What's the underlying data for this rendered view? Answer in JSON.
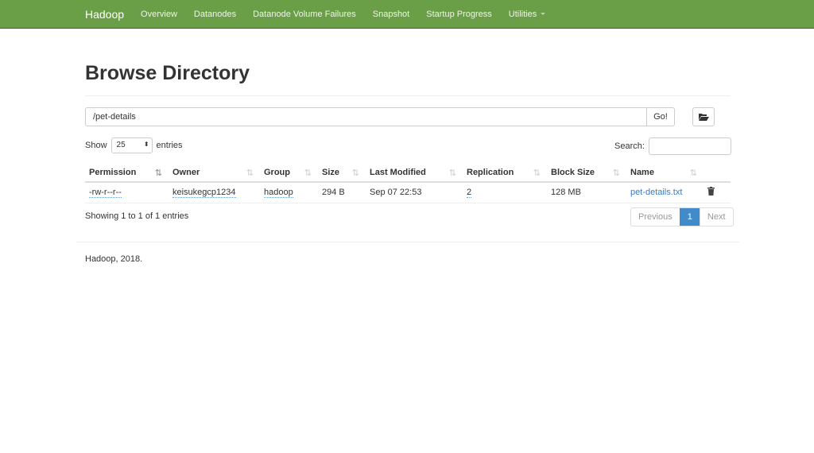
{
  "nav": {
    "brand": "Hadoop",
    "items": [
      "Overview",
      "Datanodes",
      "Datanode Volume Failures",
      "Snapshot",
      "Startup Progress",
      "Utilities"
    ]
  },
  "page": {
    "title": "Browse Directory",
    "path": "/pet-details",
    "go": "Go!",
    "folder_icon": "folder-open-icon"
  },
  "controls": {
    "show": "Show",
    "entries_value": "25",
    "entries": "entries",
    "search": "Search:",
    "search_value": ""
  },
  "table": {
    "headers": [
      "Permission",
      "Owner",
      "Group",
      "Size",
      "Last Modified",
      "Replication",
      "Block Size",
      "Name"
    ],
    "rows": [
      {
        "permission": "-rw-r--r--",
        "owner": "keisukegcp1234",
        "group": "hadoop",
        "size": "294 B",
        "modified": "Sep 07 22:53",
        "replication": "2",
        "block_size": "128 MB",
        "name": "pet-details.txt",
        "delete_icon": "trash-icon"
      }
    ]
  },
  "info": "Showing 1 to 1 of 1 entries",
  "pager": {
    "previous": "Previous",
    "current": "1",
    "next": "Next"
  },
  "footer": "Hadoop, 2018."
}
